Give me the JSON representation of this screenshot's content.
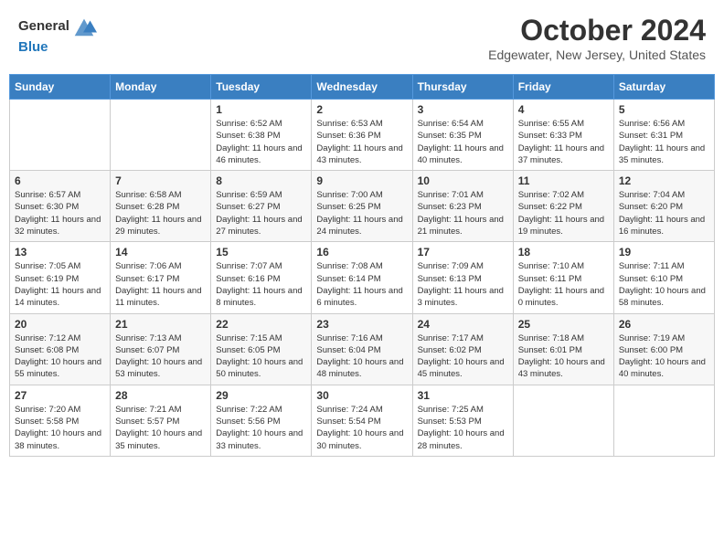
{
  "header": {
    "logo_line1": "General",
    "logo_line2": "Blue",
    "month": "October 2024",
    "location": "Edgewater, New Jersey, United States"
  },
  "days_of_week": [
    "Sunday",
    "Monday",
    "Tuesday",
    "Wednesday",
    "Thursday",
    "Friday",
    "Saturday"
  ],
  "weeks": [
    [
      {
        "day": "",
        "info": ""
      },
      {
        "day": "",
        "info": ""
      },
      {
        "day": "1",
        "info": "Sunrise: 6:52 AM\nSunset: 6:38 PM\nDaylight: 11 hours and 46 minutes."
      },
      {
        "day": "2",
        "info": "Sunrise: 6:53 AM\nSunset: 6:36 PM\nDaylight: 11 hours and 43 minutes."
      },
      {
        "day": "3",
        "info": "Sunrise: 6:54 AM\nSunset: 6:35 PM\nDaylight: 11 hours and 40 minutes."
      },
      {
        "day": "4",
        "info": "Sunrise: 6:55 AM\nSunset: 6:33 PM\nDaylight: 11 hours and 37 minutes."
      },
      {
        "day": "5",
        "info": "Sunrise: 6:56 AM\nSunset: 6:31 PM\nDaylight: 11 hours and 35 minutes."
      }
    ],
    [
      {
        "day": "6",
        "info": "Sunrise: 6:57 AM\nSunset: 6:30 PM\nDaylight: 11 hours and 32 minutes."
      },
      {
        "day": "7",
        "info": "Sunrise: 6:58 AM\nSunset: 6:28 PM\nDaylight: 11 hours and 29 minutes."
      },
      {
        "day": "8",
        "info": "Sunrise: 6:59 AM\nSunset: 6:27 PM\nDaylight: 11 hours and 27 minutes."
      },
      {
        "day": "9",
        "info": "Sunrise: 7:00 AM\nSunset: 6:25 PM\nDaylight: 11 hours and 24 minutes."
      },
      {
        "day": "10",
        "info": "Sunrise: 7:01 AM\nSunset: 6:23 PM\nDaylight: 11 hours and 21 minutes."
      },
      {
        "day": "11",
        "info": "Sunrise: 7:02 AM\nSunset: 6:22 PM\nDaylight: 11 hours and 19 minutes."
      },
      {
        "day": "12",
        "info": "Sunrise: 7:04 AM\nSunset: 6:20 PM\nDaylight: 11 hours and 16 minutes."
      }
    ],
    [
      {
        "day": "13",
        "info": "Sunrise: 7:05 AM\nSunset: 6:19 PM\nDaylight: 11 hours and 14 minutes."
      },
      {
        "day": "14",
        "info": "Sunrise: 7:06 AM\nSunset: 6:17 PM\nDaylight: 11 hours and 11 minutes."
      },
      {
        "day": "15",
        "info": "Sunrise: 7:07 AM\nSunset: 6:16 PM\nDaylight: 11 hours and 8 minutes."
      },
      {
        "day": "16",
        "info": "Sunrise: 7:08 AM\nSunset: 6:14 PM\nDaylight: 11 hours and 6 minutes."
      },
      {
        "day": "17",
        "info": "Sunrise: 7:09 AM\nSunset: 6:13 PM\nDaylight: 11 hours and 3 minutes."
      },
      {
        "day": "18",
        "info": "Sunrise: 7:10 AM\nSunset: 6:11 PM\nDaylight: 11 hours and 0 minutes."
      },
      {
        "day": "19",
        "info": "Sunrise: 7:11 AM\nSunset: 6:10 PM\nDaylight: 10 hours and 58 minutes."
      }
    ],
    [
      {
        "day": "20",
        "info": "Sunrise: 7:12 AM\nSunset: 6:08 PM\nDaylight: 10 hours and 55 minutes."
      },
      {
        "day": "21",
        "info": "Sunrise: 7:13 AM\nSunset: 6:07 PM\nDaylight: 10 hours and 53 minutes."
      },
      {
        "day": "22",
        "info": "Sunrise: 7:15 AM\nSunset: 6:05 PM\nDaylight: 10 hours and 50 minutes."
      },
      {
        "day": "23",
        "info": "Sunrise: 7:16 AM\nSunset: 6:04 PM\nDaylight: 10 hours and 48 minutes."
      },
      {
        "day": "24",
        "info": "Sunrise: 7:17 AM\nSunset: 6:02 PM\nDaylight: 10 hours and 45 minutes."
      },
      {
        "day": "25",
        "info": "Sunrise: 7:18 AM\nSunset: 6:01 PM\nDaylight: 10 hours and 43 minutes."
      },
      {
        "day": "26",
        "info": "Sunrise: 7:19 AM\nSunset: 6:00 PM\nDaylight: 10 hours and 40 minutes."
      }
    ],
    [
      {
        "day": "27",
        "info": "Sunrise: 7:20 AM\nSunset: 5:58 PM\nDaylight: 10 hours and 38 minutes."
      },
      {
        "day": "28",
        "info": "Sunrise: 7:21 AM\nSunset: 5:57 PM\nDaylight: 10 hours and 35 minutes."
      },
      {
        "day": "29",
        "info": "Sunrise: 7:22 AM\nSunset: 5:56 PM\nDaylight: 10 hours and 33 minutes."
      },
      {
        "day": "30",
        "info": "Sunrise: 7:24 AM\nSunset: 5:54 PM\nDaylight: 10 hours and 30 minutes."
      },
      {
        "day": "31",
        "info": "Sunrise: 7:25 AM\nSunset: 5:53 PM\nDaylight: 10 hours and 28 minutes."
      },
      {
        "day": "",
        "info": ""
      },
      {
        "day": "",
        "info": ""
      }
    ]
  ]
}
